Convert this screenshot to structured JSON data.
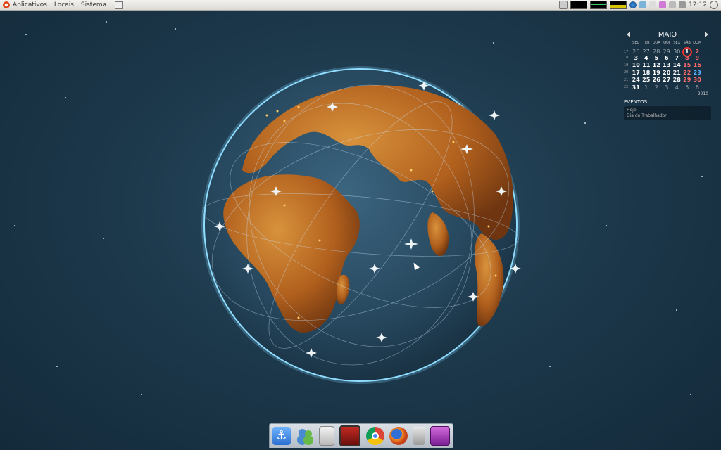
{
  "top_panel": {
    "menus": [
      "Aplicativos",
      "Locais",
      "Sistema"
    ],
    "clock": "12:12"
  },
  "calendar": {
    "month": "MAIO",
    "year": "2010",
    "day_names": [
      "SEG",
      "TER",
      "QUA",
      "QUI",
      "SEX",
      "SÁB",
      "DOM"
    ],
    "weeks": [
      {
        "num": "17",
        "days": [
          "26",
          "27",
          "28",
          "29",
          "30",
          "1",
          "2"
        ]
      },
      {
        "num": "18",
        "days": [
          "3",
          "4",
          "5",
          "6",
          "7",
          "8",
          "9"
        ]
      },
      {
        "num": "19",
        "days": [
          "10",
          "11",
          "12",
          "13",
          "14",
          "15",
          "16"
        ]
      },
      {
        "num": "20",
        "days": [
          "17",
          "18",
          "19",
          "20",
          "21",
          "22",
          "23"
        ]
      },
      {
        "num": "21",
        "days": [
          "24",
          "25",
          "26",
          "27",
          "28",
          "29",
          "30"
        ]
      },
      {
        "num": "22",
        "days": [
          "31",
          "1",
          "2",
          "3",
          "4",
          "5",
          "6"
        ]
      }
    ],
    "events_title": "EVENTOS:",
    "events": [
      "Hoje",
      "Dia do Trabalhador"
    ]
  },
  "dock": {
    "icons": [
      "anchor-icon",
      "people-icon",
      "drive-icon",
      "video-icon",
      "chrome-icon",
      "firefox-icon",
      "trash-icon",
      "screen-icon"
    ]
  },
  "colors": {
    "background": "#1d394c",
    "land": "#b8651c",
    "ocean": "#2b4f68",
    "today_ring": "#ee3333"
  }
}
